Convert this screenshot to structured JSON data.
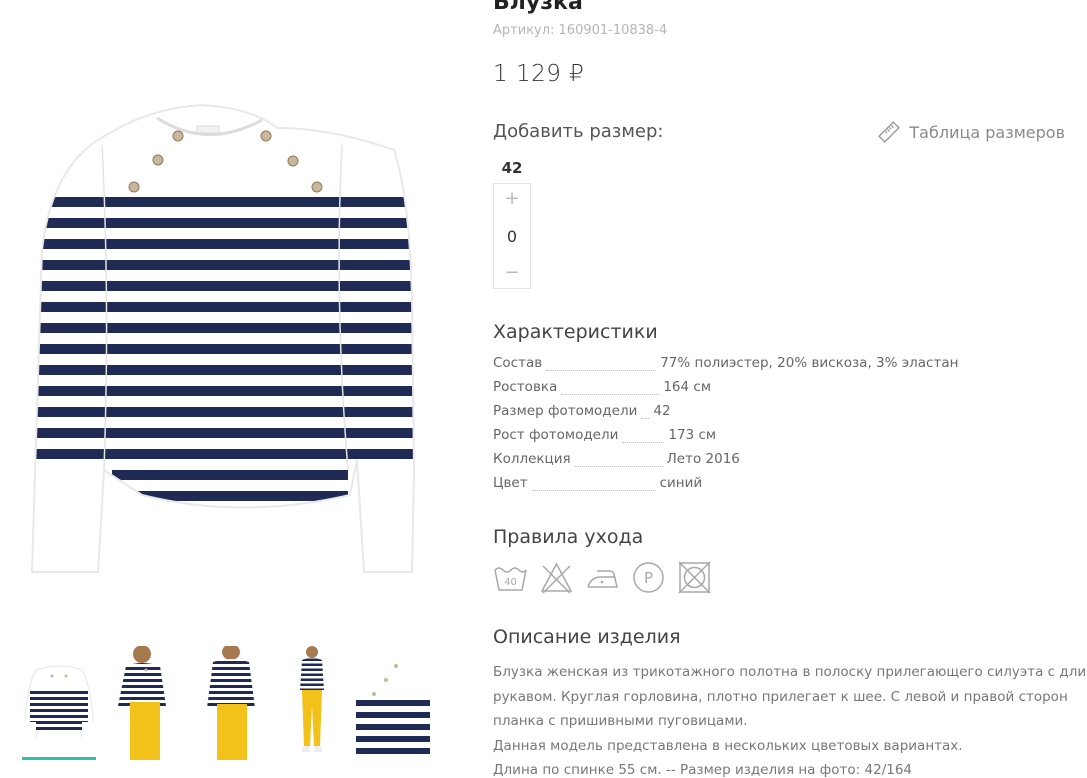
{
  "product": {
    "title": "Блузка",
    "sku": "Артикул: 160901-10838-4",
    "price": "1 129 ₽"
  },
  "sizes": {
    "heading": "Добавить размер:",
    "size_table_link": "Таблица размеров",
    "items": [
      {
        "label": "42",
        "quantity": "0",
        "plus": "+",
        "minus": "−"
      }
    ]
  },
  "characteristics": {
    "heading": "Характеристики",
    "rows": [
      {
        "label": "Состав",
        "value": "77% полиэстер, 20% вискоза, 3% эластан"
      },
      {
        "label": "Ростовка",
        "value": "164 см"
      },
      {
        "label": "Размер фотомодели",
        "value": "42"
      },
      {
        "label": "Рост фотомодели",
        "value": "173 см"
      },
      {
        "label": "Коллекция",
        "value": "Лето 2016"
      },
      {
        "label": "Цвет",
        "value": "синий"
      }
    ]
  },
  "care": {
    "heading": "Правила ухода",
    "icons": [
      "wash-40-icon",
      "no-bleach-icon",
      "iron-low-icon",
      "dry-clean-p-icon",
      "no-tumble-dry-icon"
    ],
    "wash_temp": "40",
    "dry_clean_letter": "P"
  },
  "description": {
    "heading": "Описание изделия",
    "lines": [
      "Блузка женская из трикотажного полотна в полоску прилегающего силуэта с длинным",
      "рукавом. Круглая горловина, плотно прилегает к шее. С левой и правой сторон",
      "планка с пришивными пуговицами.",
      "Данная модель представлена в нескольких цветовых вариантах.",
      "Длина по спинке 55 см. -- Размер изделия на фото: 42/164"
    ]
  },
  "gallery": {
    "thumbnails": [
      "Фото 1",
      "Фото 2",
      "Фото 3",
      "Фото 4",
      "Фото 5"
    ],
    "active_index": 0
  },
  "colors": {
    "accent": "#2bc3a5",
    "stripe": "#1f2a55",
    "muted_text": "#b5b5b5",
    "pants": "#f2c21a"
  }
}
